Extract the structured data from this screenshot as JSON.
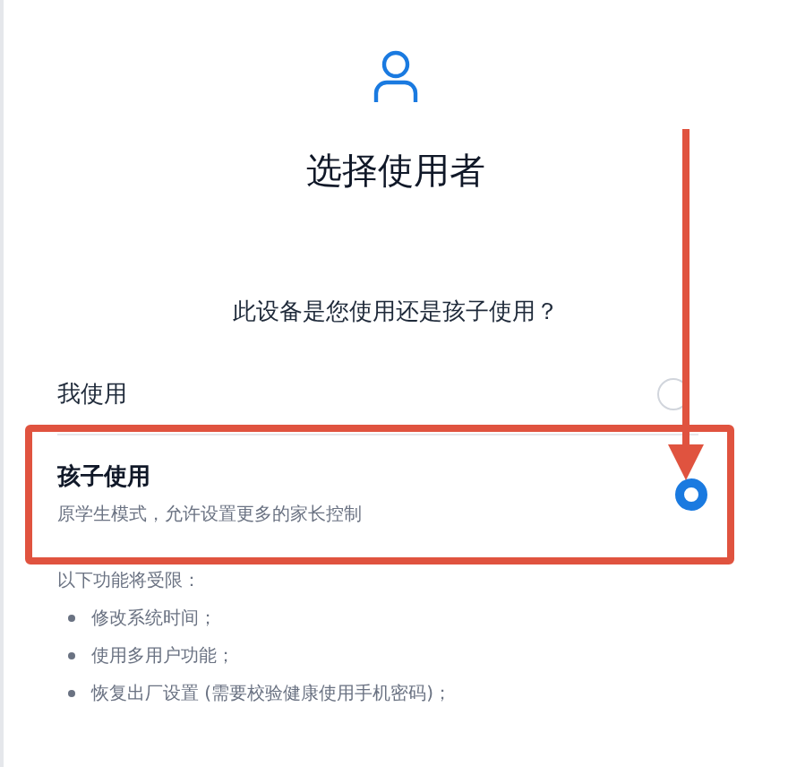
{
  "title": "选择使用者",
  "question": "此设备是您使用还是孩子使用？",
  "options": [
    {
      "label": "我使用",
      "selected": false
    },
    {
      "label": "孩子使用",
      "description": "原学生模式，允许设置更多的家长控制",
      "selected": true
    }
  ],
  "restrictions": {
    "heading": "以下功能将受限：",
    "items": [
      "修改系统时间；",
      "使用多用户功能；",
      "恢复出厂设置 (需要校验健康使用手机密码)；"
    ]
  }
}
